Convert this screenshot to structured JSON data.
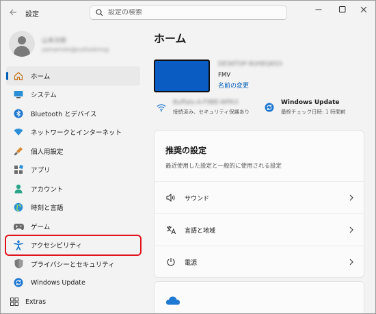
{
  "app": {
    "title": "設定",
    "search_placeholder": "設定の検索",
    "colors": {
      "accent": "#005fb8",
      "highlight": "#e0131b",
      "device": "#0a5bc2"
    }
  },
  "sidebar": {
    "profile": {
      "name": "山本次郎",
      "email": "yamamoto@outlookmsg"
    },
    "items": [
      {
        "label": "ホーム",
        "icon": "home-icon",
        "selected": true
      },
      {
        "label": "システム",
        "icon": "system-icon"
      },
      {
        "label": "Bluetooth とデバイス",
        "icon": "bluetooth-icon"
      },
      {
        "label": "ネットワークとインターネット",
        "icon": "wifi-icon"
      },
      {
        "label": "個人用設定",
        "icon": "personalization-icon"
      },
      {
        "label": "アプリ",
        "icon": "apps-icon"
      },
      {
        "label": "アカウント",
        "icon": "account-icon"
      },
      {
        "label": "時刻と言語",
        "icon": "time-language-icon"
      },
      {
        "label": "ゲーム",
        "icon": "gaming-icon"
      },
      {
        "label": "アクセシビリティ",
        "icon": "accessibility-icon",
        "highlighted": true
      },
      {
        "label": "プライバシーとセキュリティ",
        "icon": "shield-icon"
      },
      {
        "label": "Windows Update",
        "icon": "windows-update-icon"
      }
    ],
    "extras_label": "Extras"
  },
  "main": {
    "title": "ホーム",
    "device": {
      "name": "DESKTOP-9UHEQKS3",
      "model": "FMV",
      "rename_link": "名前の変更"
    },
    "network": {
      "name": "Buffalo-A-F9BE-WPA3",
      "status": "接続済み、セキュリティ保護あり"
    },
    "update": {
      "title": "Windows Update",
      "status": "最終チェック日時: 1 時間前"
    },
    "recommended": {
      "title": "推奨の設定",
      "subtitle": "最近使用した設定と一般的に使用される設定",
      "items": [
        {
          "label": "サウンド",
          "icon": "speaker-icon"
        },
        {
          "label": "言語と地域",
          "icon": "language-icon"
        },
        {
          "label": "電源",
          "icon": "power-icon"
        }
      ]
    },
    "cloud_icon": "onedrive-cloud-icon"
  }
}
